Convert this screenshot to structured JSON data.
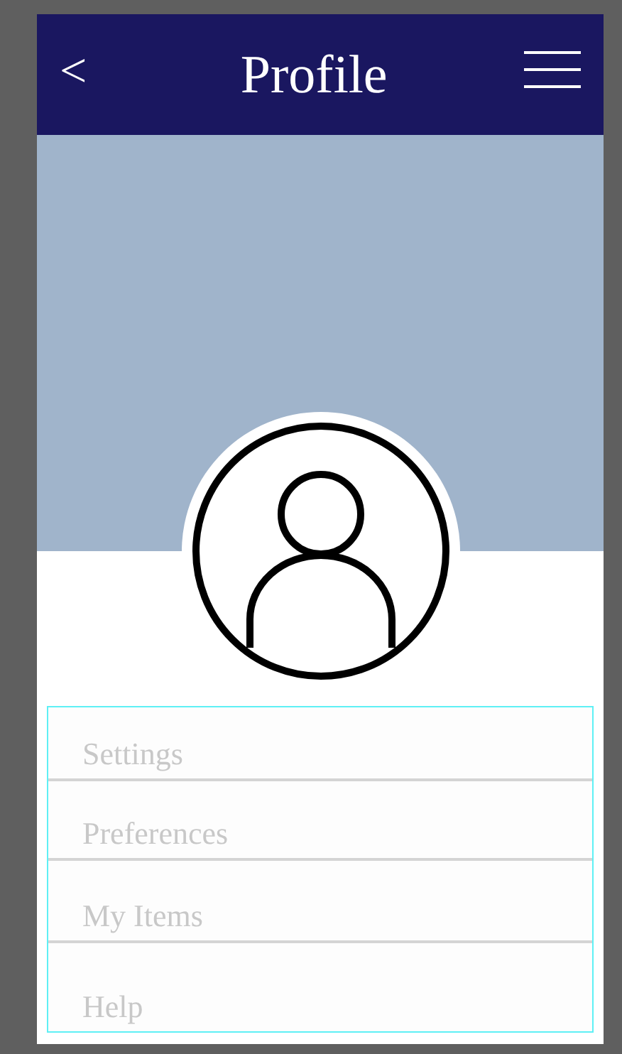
{
  "header": {
    "back": "<",
    "title": "Profile"
  },
  "menu_items": [
    {
      "label": "Settings"
    },
    {
      "label": "Preferences"
    },
    {
      "label": "My Items"
    },
    {
      "label": "Help"
    }
  ]
}
